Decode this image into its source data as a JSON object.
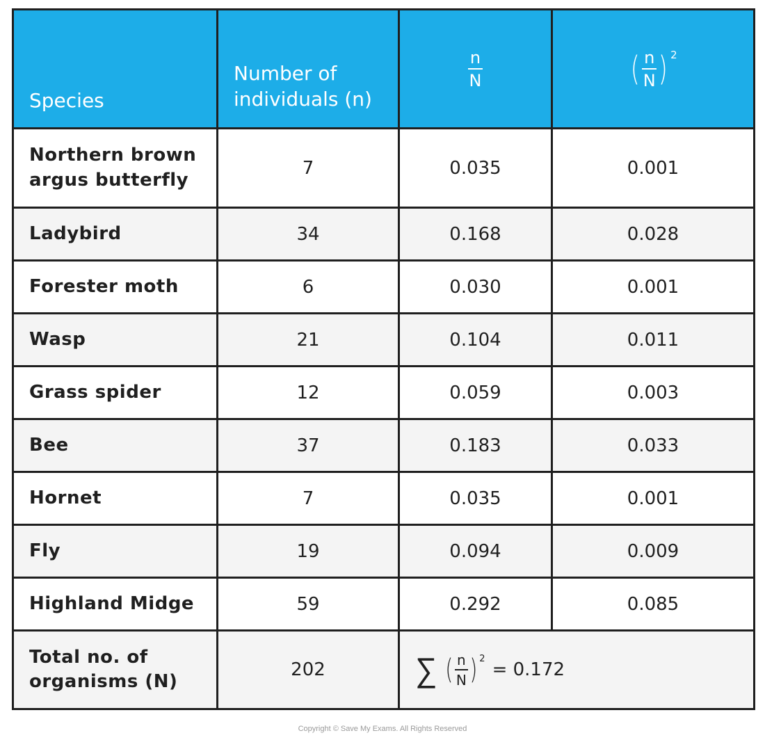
{
  "table": {
    "headers": {
      "species": "Species",
      "number_line1": "Number of",
      "number_line2": "individuals (n)",
      "frac_num": "n",
      "frac_den": "N",
      "frac2_num": "n",
      "frac2_den": "N",
      "frac2_exp": "2"
    },
    "rows": [
      {
        "species_line1": "Northern brown",
        "species_line2": "argus butterfly",
        "n": "7",
        "n_over_N": "0.035",
        "n_over_N_sq": "0.001"
      },
      {
        "species": "Ladybird",
        "n": "34",
        "n_over_N": "0.168",
        "n_over_N_sq": "0.028"
      },
      {
        "species": "Forester moth",
        "n": "6",
        "n_over_N": "0.030",
        "n_over_N_sq": "0.001"
      },
      {
        "species": "Wasp",
        "n": "21",
        "n_over_N": "0.104",
        "n_over_N_sq": "0.011"
      },
      {
        "species": "Grass spider",
        "n": "12",
        "n_over_N": "0.059",
        "n_over_N_sq": "0.003"
      },
      {
        "species": "Bee",
        "n": "37",
        "n_over_N": "0.183",
        "n_over_N_sq": "0.033"
      },
      {
        "species": "Hornet",
        "n": "7",
        "n_over_N": "0.035",
        "n_over_N_sq": "0.001"
      },
      {
        "species": "Fly",
        "n": "19",
        "n_over_N": "0.094",
        "n_over_N_sq": "0.009"
      },
      {
        "species": "Highland Midge",
        "n": "59",
        "n_over_N": "0.292",
        "n_over_N_sq": "0.085"
      }
    ],
    "total": {
      "label_line1": "Total no. of",
      "label_line2": "organisms (N)",
      "N": "202",
      "sum_symbol": "∑",
      "sum_num": "n",
      "sum_den": "N",
      "sum_exp": "2",
      "sum_value": "= 0.172"
    }
  },
  "colors": {
    "header_bg": "#1DADE8",
    "border": "#1f1f1f",
    "row_alt": "#f4f4f4"
  },
  "footer": {
    "copyright": "Copyright © Save My Exams. All Rights Reserved"
  }
}
